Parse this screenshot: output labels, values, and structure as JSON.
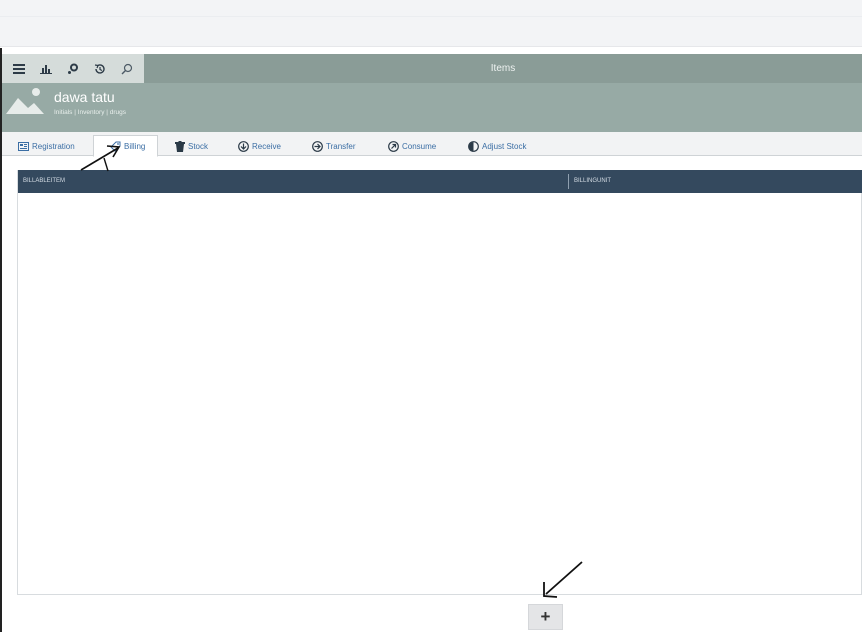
{
  "toolbar": {
    "title": "Items",
    "buttons": [
      {
        "name": "menu-icon"
      },
      {
        "name": "chart-icon"
      },
      {
        "name": "settings-icon"
      },
      {
        "name": "history-icon"
      },
      {
        "name": "search-icon"
      }
    ]
  },
  "header": {
    "name": "dawa tatu",
    "breadcrumb": "Initials | Inventory | drugs"
  },
  "tabs": [
    {
      "label": "Registration",
      "icon": "list-icon",
      "active": false
    },
    {
      "label": "Billing",
      "icon": "tag-icon",
      "active": true
    },
    {
      "label": "Stock",
      "icon": "trash-icon",
      "active": false
    },
    {
      "label": "Receive",
      "icon": "arrow-down-circle-icon",
      "active": false
    },
    {
      "label": "Transfer",
      "icon": "arrow-right-circle-icon",
      "active": false
    },
    {
      "label": "Consume",
      "icon": "arrow-up-right-circle-icon",
      "active": false
    },
    {
      "label": "Adjust Stock",
      "icon": "half-circle-icon",
      "active": false
    }
  ],
  "grid": {
    "columns": [
      "BILLABLEITEM",
      "BILLINGUNIT"
    ],
    "rows": []
  },
  "add_button": {
    "label": "+"
  },
  "colors": {
    "toolbar": "#8a9c97",
    "header": "#97aaa5",
    "grid_header": "#34495e",
    "link": "#3b6ea4"
  }
}
